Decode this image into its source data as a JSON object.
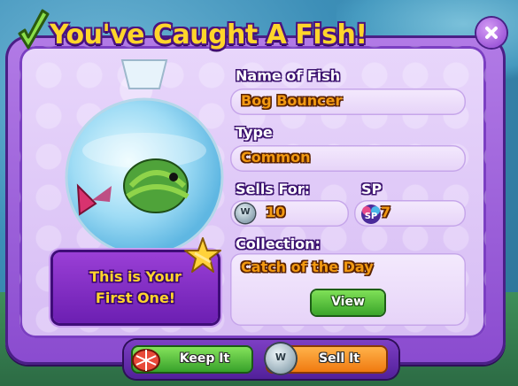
{
  "title": "You've Caught A Fish!",
  "fish": {
    "name_label": "Name of Fish",
    "name_value": "Bog Bouncer",
    "type_label": "Type",
    "type_value": "Common",
    "sells_label": "Sells For:",
    "sells_value": "10",
    "sp_label": "SP",
    "sp_value": "7",
    "collection_label": "Collection:",
    "collection_value": "Catch of the Day"
  },
  "first_one_text_line1": "This is Your",
  "first_one_text_line2": "First One!",
  "buttons": {
    "view": "View",
    "keep": "Keep It",
    "sell": "Sell It"
  },
  "icons": {
    "check": "check-icon",
    "close": "close-icon",
    "coin": "coin-icon",
    "sp": "sp-icon",
    "star": "star-icon",
    "keep": "fishing-net-icon",
    "sell": "coin-icon"
  },
  "colors": {
    "panel": "#8a4bcf",
    "title_text": "#ffd52b",
    "field_text": "#f29a12",
    "keep_button": "#37a12a",
    "sell_button": "#f07a10",
    "view_button": "#3aa52a"
  }
}
